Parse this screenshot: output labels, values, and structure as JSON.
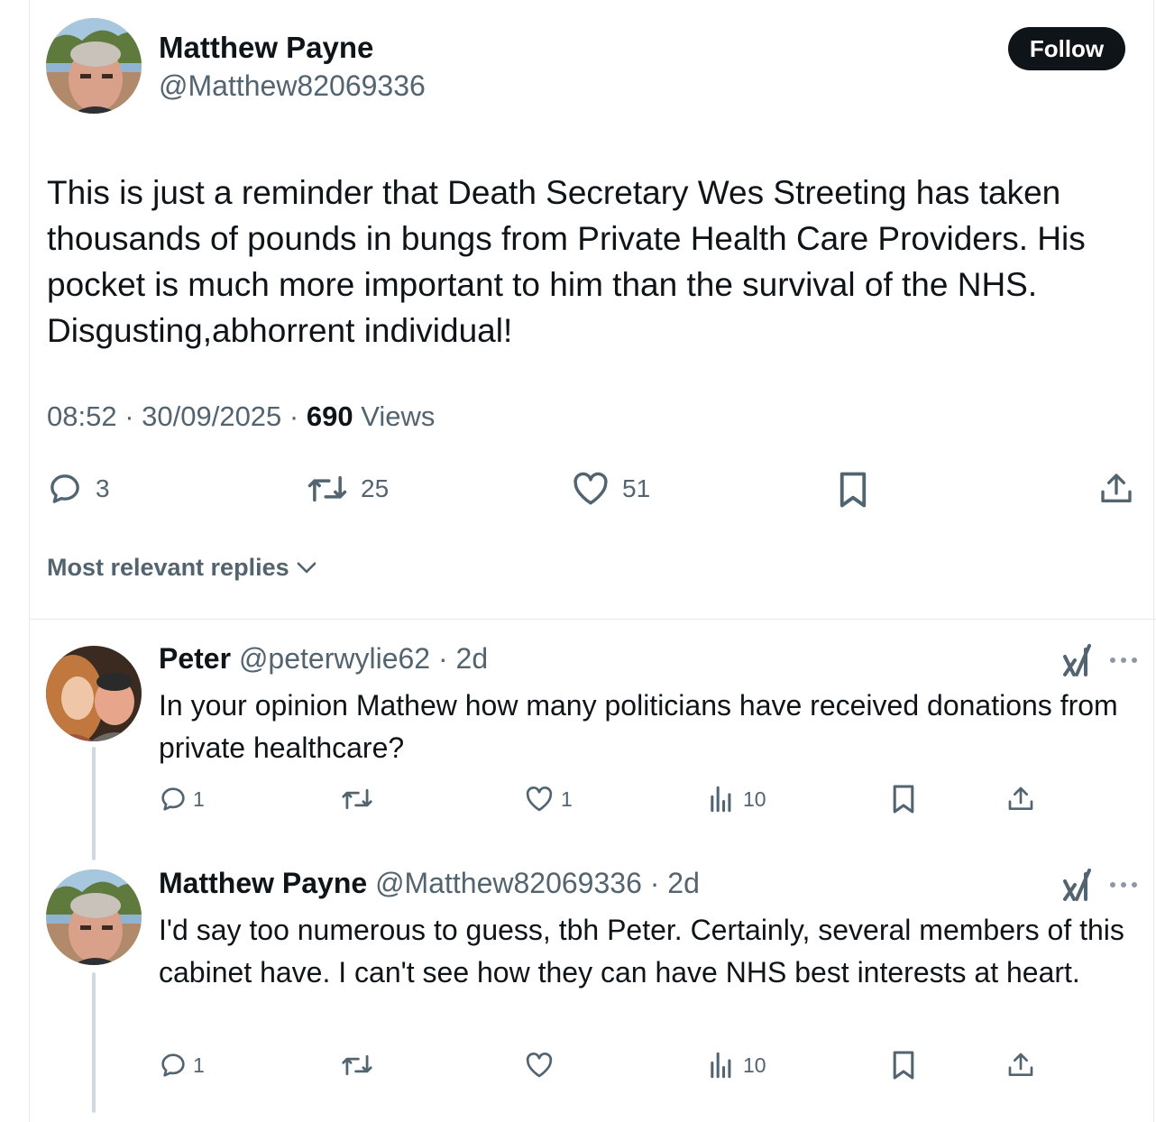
{
  "post": {
    "author_name": "Matthew Payne",
    "author_handle": "@Matthew82069336",
    "follow_label": "Follow",
    "text": "This is just a reminder that Death Secretary Wes Streeting has taken thousands of pounds in bungs from Private Health Care Providers. His pocket is much more important to him than the survival of the NHS. Disgusting,abhorrent individual!",
    "time": "08:52",
    "date": "30/09/2025",
    "views_count": "690",
    "views_label": "Views",
    "replies": "3",
    "reposts": "25",
    "likes": "51"
  },
  "replies_sort_label": "Most relevant replies",
  "replies": [
    {
      "author_name": "Peter",
      "author_handle": "@peterwylie62",
      "age": "2d",
      "text": "In your opinion Mathew how many politicians have received donations from private healthcare?",
      "replies": "1",
      "reposts": "",
      "likes": "1",
      "views": "10"
    },
    {
      "author_name": "Matthew Payne",
      "author_handle": "@Matthew82069336",
      "age": "2d",
      "text": "I'd say too numerous to guess, tbh Peter. Certainly, several members of this cabinet have. I can't see how they can have NHS best interests at heart.",
      "replies": "1",
      "reposts": "",
      "likes": "",
      "views": "10"
    }
  ],
  "separator": "·",
  "colors": {
    "text": "#0f1419",
    "secondary": "#536471",
    "border": "#e6e9ec",
    "thread": "#cfd9de"
  },
  "icons": [
    "reply-icon",
    "repost-icon",
    "like-icon",
    "bookmark-icon",
    "share-icon",
    "views-icon",
    "grok-icon",
    "more-icon",
    "chevron-down-icon"
  ]
}
